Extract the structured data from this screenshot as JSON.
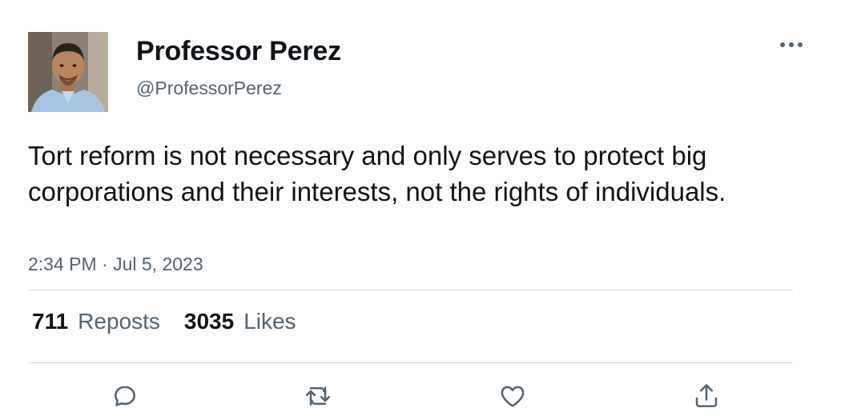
{
  "author": {
    "display_name": "Professor Perez",
    "handle": "@ProfessorPerez"
  },
  "post": {
    "text": "Tort reform is not necessary and only serves to protect big corporations and their interests, not the rights of individuals.",
    "timestamp": "2:34 PM · Jul 5, 2023"
  },
  "stats": {
    "reposts_count": "711",
    "reposts_label": "Reposts",
    "likes_count": "3035",
    "likes_label": "Likes"
  },
  "actions": [
    "reply-icon",
    "repost-icon",
    "like-icon",
    "share-icon"
  ],
  "colors": {
    "text_primary": "#0f1419",
    "text_secondary": "#536471",
    "divider": "#cfd9de"
  }
}
